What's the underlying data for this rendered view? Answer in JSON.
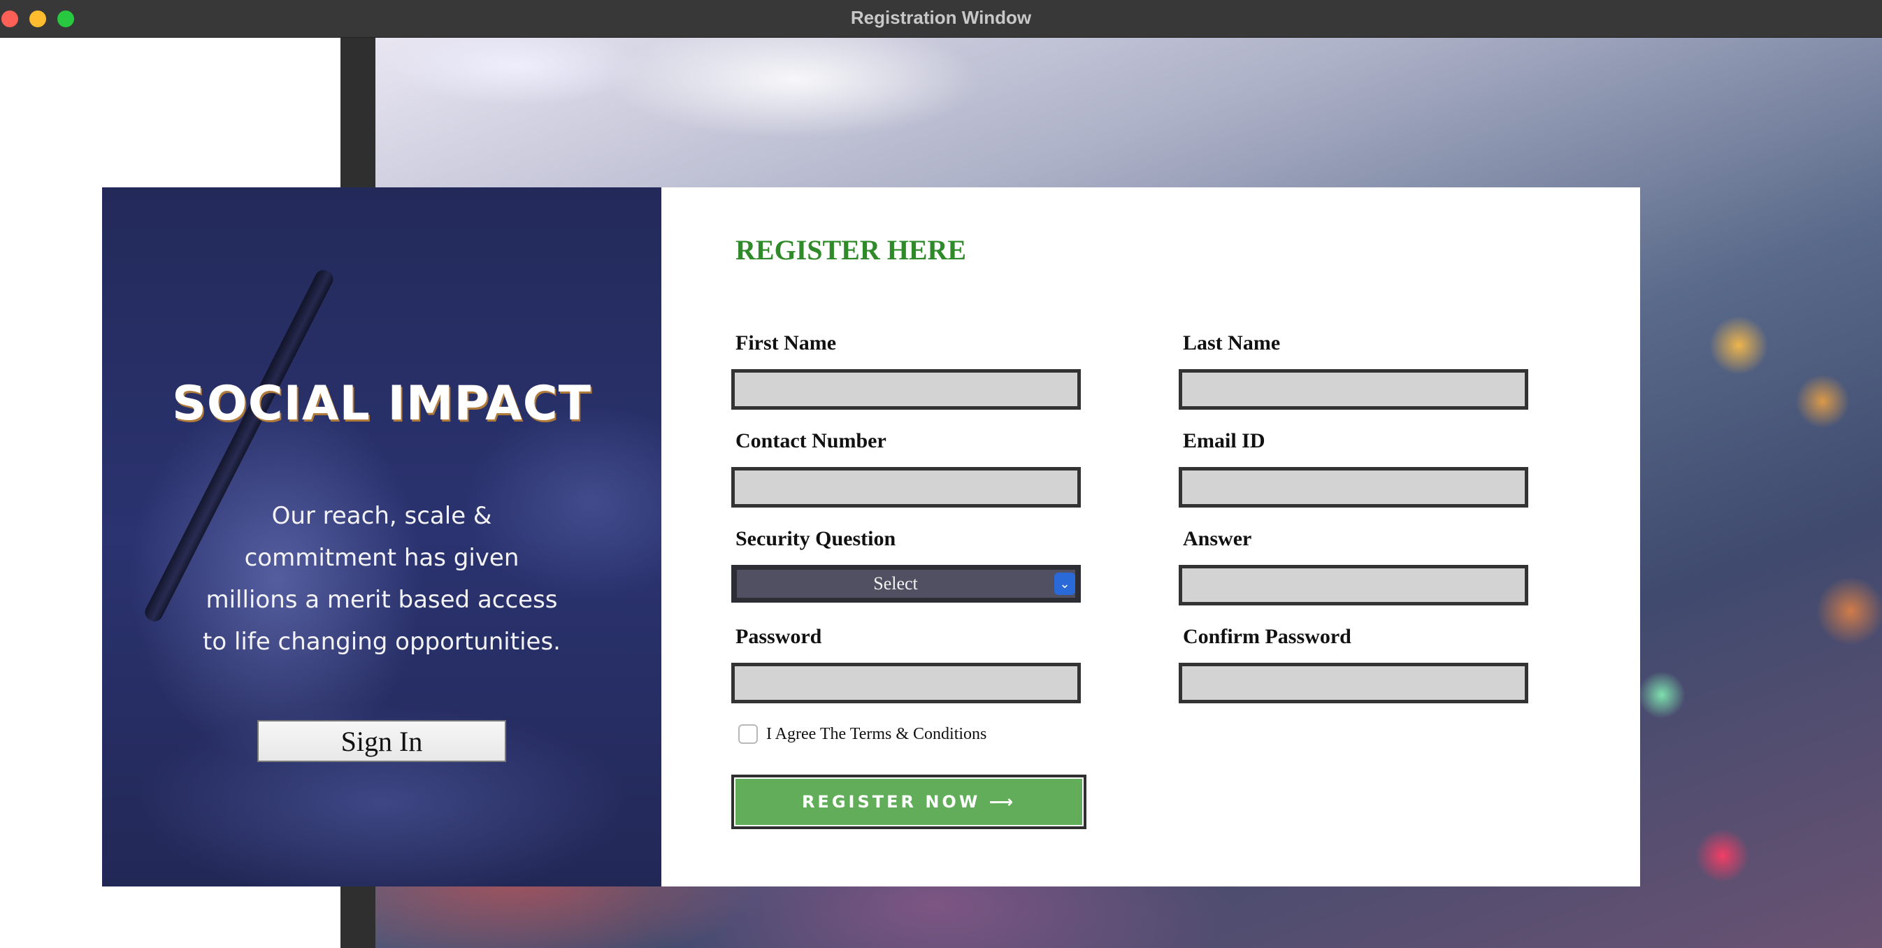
{
  "window": {
    "title": "Registration Window"
  },
  "hero": {
    "title": "SOCIAL IMPACT",
    "text": "Our reach, scale & commitment has given millions a merit based access to life changing opportunities.",
    "signin_label": "Sign In"
  },
  "form": {
    "title": "REGISTER HERE",
    "first_name_label": "First Name",
    "last_name_label": "Last Name",
    "contact_label": "Contact Number",
    "email_label": "Email ID",
    "security_label": "Security Question",
    "security_selected": "Select",
    "answer_label": "Answer",
    "password_label": "Password",
    "confirm_password_label": "Confirm Password",
    "agree_label": "I Agree The Terms & Conditions",
    "agree_checked": false,
    "register_label": "REGISTER NOW ⟶"
  },
  "colors": {
    "accent_green": "#2f8a2a",
    "button_green": "#62ad5a",
    "hero_bg": "#2b3370",
    "input_bg": "#d3d3d3"
  }
}
